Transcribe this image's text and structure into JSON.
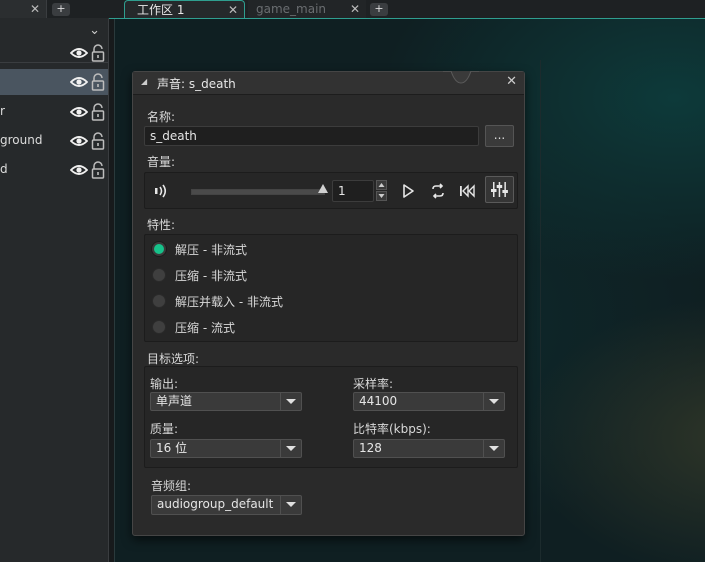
{
  "top_tabs": {
    "left_close": "✕",
    "left_plus": "+",
    "workspace1_label": "工作区 1",
    "workspace1_close": "✕",
    "game_main_label": "game_main",
    "game_main_close": "✕",
    "plus": "+"
  },
  "left_panel": {
    "rows": [
      {
        "label": ""
      },
      {
        "label": ""
      },
      {
        "label": "r"
      },
      {
        "label": "ground"
      },
      {
        "label": "d"
      }
    ]
  },
  "dialog": {
    "title": "声音: s_death",
    "close": "✕",
    "name_label": "名称:",
    "name_value": "s_death",
    "browse_label": "...",
    "volume_label": "音量:",
    "volume_value": "1",
    "volume_level": 1.0,
    "properties_label": "特性:",
    "properties_options": [
      {
        "label": "解压 - 非流式",
        "selected": true
      },
      {
        "label": "压缩 - 非流式",
        "selected": false
      },
      {
        "label": "解压并载入 - 非流式",
        "selected": false
      },
      {
        "label": "压缩 - 流式",
        "selected": false
      }
    ],
    "target_label": "目标选项:",
    "output_label": "输出:",
    "output_value": "单声道",
    "sample_rate_label": "采样率:",
    "sample_rate_value": "44100",
    "quality_label": "质量:",
    "quality_value": "16 位",
    "bitrate_label": "比特率(kbps):",
    "bitrate_value": "128",
    "audio_group_label": "音频组:",
    "audio_group_value": "audiogroup_default"
  },
  "colors": {
    "accent": "#2f9e8f",
    "radio_selected": "#17c28a"
  }
}
